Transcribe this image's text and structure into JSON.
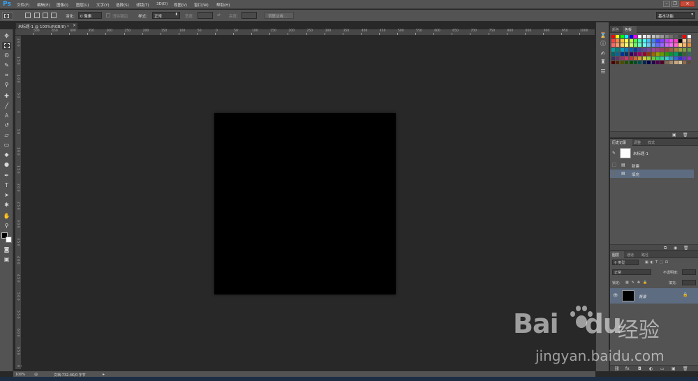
{
  "app": {
    "logo": "Ps"
  },
  "menu": [
    "文件(F)",
    "编辑(E)",
    "图像(I)",
    "图层(L)",
    "文字(Y)",
    "选择(S)",
    "滤镜(T)",
    "3D(D)",
    "视图(V)",
    "窗口(W)",
    "帮助(H)"
  ],
  "window_controls": {
    "minimize": "–",
    "restore": "❐",
    "close": "✕"
  },
  "options": {
    "feather_label": "羽化:",
    "feather_value": "0 像素",
    "antialias_label": "消除锯齿",
    "style_label": "样式:",
    "style_value": "正常",
    "width_label": "宽度:",
    "height_label": "高度:",
    "refine_edge": "调整边缘...",
    "workspace": "基本功能"
  },
  "document": {
    "tab_title": "未标题-1 @ 100%(RGB/8) *",
    "close_glyph": "×",
    "zoom": "100%",
    "doc_info": "文档:732.4K/0 字节",
    "canvas_color": "#000000"
  },
  "ruler": {
    "h_labels": [
      "500",
      "450",
      "400",
      "350",
      "300",
      "250",
      "200",
      "150",
      "100",
      "50",
      "0",
      "50",
      "100",
      "150",
      "200",
      "250",
      "300",
      "350",
      "400",
      "450",
      "500",
      "550",
      "600",
      "650",
      "700",
      "750",
      "800",
      "850",
      "900",
      "950",
      "1000"
    ],
    "v_labels": [
      "2 0 0",
      "1 5 0",
      "1 0 0",
      "5 0",
      "0",
      "5 0",
      "1 0 0",
      "1 5 0",
      "2 0 0",
      "2 5 0",
      "3 0 0",
      "3 5 0",
      "4 0 0",
      "4 5 0",
      "5 0 0",
      "5 5 0",
      "6 0 0",
      "6 5 0",
      "7 0 0"
    ]
  },
  "swatches_panel": {
    "tabs": [
      "颜色",
      "色板"
    ],
    "active_tab": "色板",
    "colors": [
      [
        "#ff0000",
        "#ffff00",
        "#00ff00",
        "#00ffff",
        "#0000ff",
        "#ff00ff",
        "#ffffff",
        "#ebebeb",
        "#d6d6d6",
        "#c2c2c2",
        "#adadad",
        "#999999",
        "#858585",
        "#707070",
        "#5c5c5c",
        "#474747",
        "#ff0000",
        "#ffffff"
      ],
      [
        "#ff4040",
        "#ff8040",
        "#ffbf40",
        "#ffff40",
        "#bfff40",
        "#40ff40",
        "#40ffbf",
        "#40ffff",
        "#40bfff",
        "#4080ff",
        "#4040ff",
        "#8040ff",
        "#bf40ff",
        "#ff40ff",
        "#ff40bf",
        "#000000",
        "#ffcc99",
        "#cc9966"
      ],
      [
        "#ff6666",
        "#ff9966",
        "#ffcc66",
        "#ffff66",
        "#ccff66",
        "#66ff66",
        "#66ffcc",
        "#66ffff",
        "#66ccff",
        "#6699ff",
        "#6666ff",
        "#9966ff",
        "#cc66ff",
        "#ff66ff",
        "#ff66cc",
        "#ffd27f",
        "#ffb366",
        "#e69138"
      ],
      [
        "#00a0a0",
        "#008080",
        "#00a0c0",
        "#0080c0",
        "#0060c0",
        "#0040a0",
        "#4040a0",
        "#6040a0",
        "#8040a0",
        "#a040a0",
        "#a04080",
        "#a04060",
        "#a04040",
        "#a06040",
        "#a08040",
        "#a0a040",
        "#80a040",
        "#60a040"
      ],
      [
        "#006666",
        "#006699",
        "#003399",
        "#003366",
        "#330066",
        "#660066",
        "#990066",
        "#990033",
        "#993300",
        "#996600",
        "#999900",
        "#669900",
        "#339900",
        "#009933",
        "#009966",
        "#006633",
        "#336633",
        "#336666"
      ],
      [
        "#333366",
        "#663366",
        "#993366",
        "#cc3366",
        "#cc3333",
        "#cc6633",
        "#cc9933",
        "#cccc33",
        "#99cc33",
        "#66cc33",
        "#33cc66",
        "#33cc99",
        "#33cccc",
        "#3399cc",
        "#3366cc",
        "#3333cc",
        "#6633cc",
        "#9933cc"
      ],
      [
        "#4d0000",
        "#4d2600",
        "#4d4d00",
        "#264d00",
        "#004d00",
        "#004d26",
        "#004d4d",
        "#00264d",
        "#00004d",
        "#26004d",
        "#4d004d",
        "#4d0026",
        "#7f6a55",
        "#a58b6f",
        "#c8a882",
        "#d9bf99",
        "#8c6a4a",
        "#5c4a3a"
      ]
    ]
  },
  "history_panel": {
    "tabs": [
      "历史记录",
      "调整",
      "样式"
    ],
    "active_tab": "历史记录",
    "snapshot": "未标题-1",
    "steps": [
      "新建",
      "填充"
    ],
    "selected_step": "填充"
  },
  "layers_panel": {
    "tabs": [
      "图层",
      "通道",
      "路径"
    ],
    "active_tab": "图层",
    "filter_kind": "类型",
    "blend_mode": "正常",
    "opacity_label": "不透明度:",
    "lock_label": "锁定:",
    "fill_label": "填充:",
    "layers": [
      {
        "name": "背景",
        "thumb_color": "#000000",
        "locked": true,
        "visible": true
      }
    ]
  },
  "watermark": {
    "brand_a": "Bai",
    "brand_b": "du",
    "brand_cn": "经验",
    "url": "jingyan.baidu.com"
  }
}
